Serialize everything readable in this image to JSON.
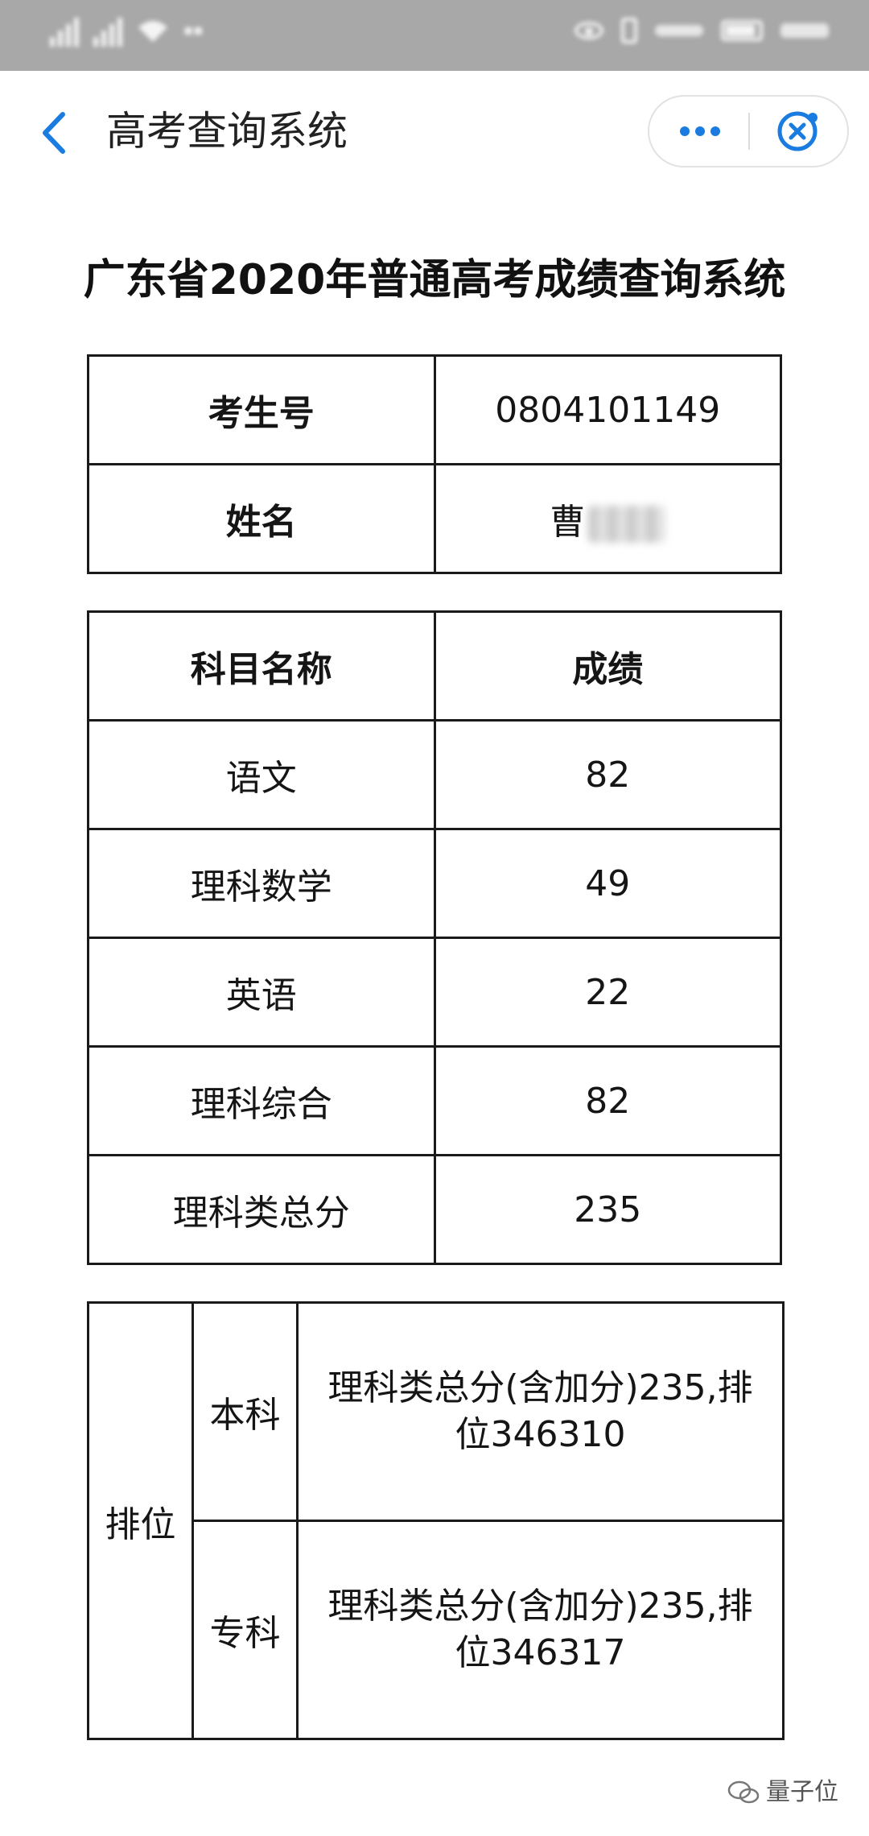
{
  "nav": {
    "title": "高考查询系统"
  },
  "page": {
    "heading": "广东省2020年普通高考成绩查询系统"
  },
  "candidate": {
    "id_label": "考生号",
    "id_value": "0804101149",
    "name_label": "姓名",
    "name_visible": "曹"
  },
  "scores": {
    "header_subject": "科目名称",
    "header_score": "成绩",
    "rows": [
      {
        "subject": "语文",
        "score": "82"
      },
      {
        "subject": "理科数学",
        "score": "49"
      },
      {
        "subject": "英语",
        "score": "22"
      },
      {
        "subject": "理科综合",
        "score": "82"
      },
      {
        "subject": "理科类总分",
        "score": "235"
      }
    ]
  },
  "ranking": {
    "label": "排位",
    "undergrad_label": "本科",
    "undergrad_text": "理科类总分(含加分)235,排位346310",
    "college_label": "专科",
    "college_text": "理科类总分(含加分)235,排位346317"
  },
  "watermark": {
    "text": "量子位"
  },
  "colors": {
    "status_bar": "#a8a8a8",
    "accent_blue": "#1a7ce0"
  }
}
